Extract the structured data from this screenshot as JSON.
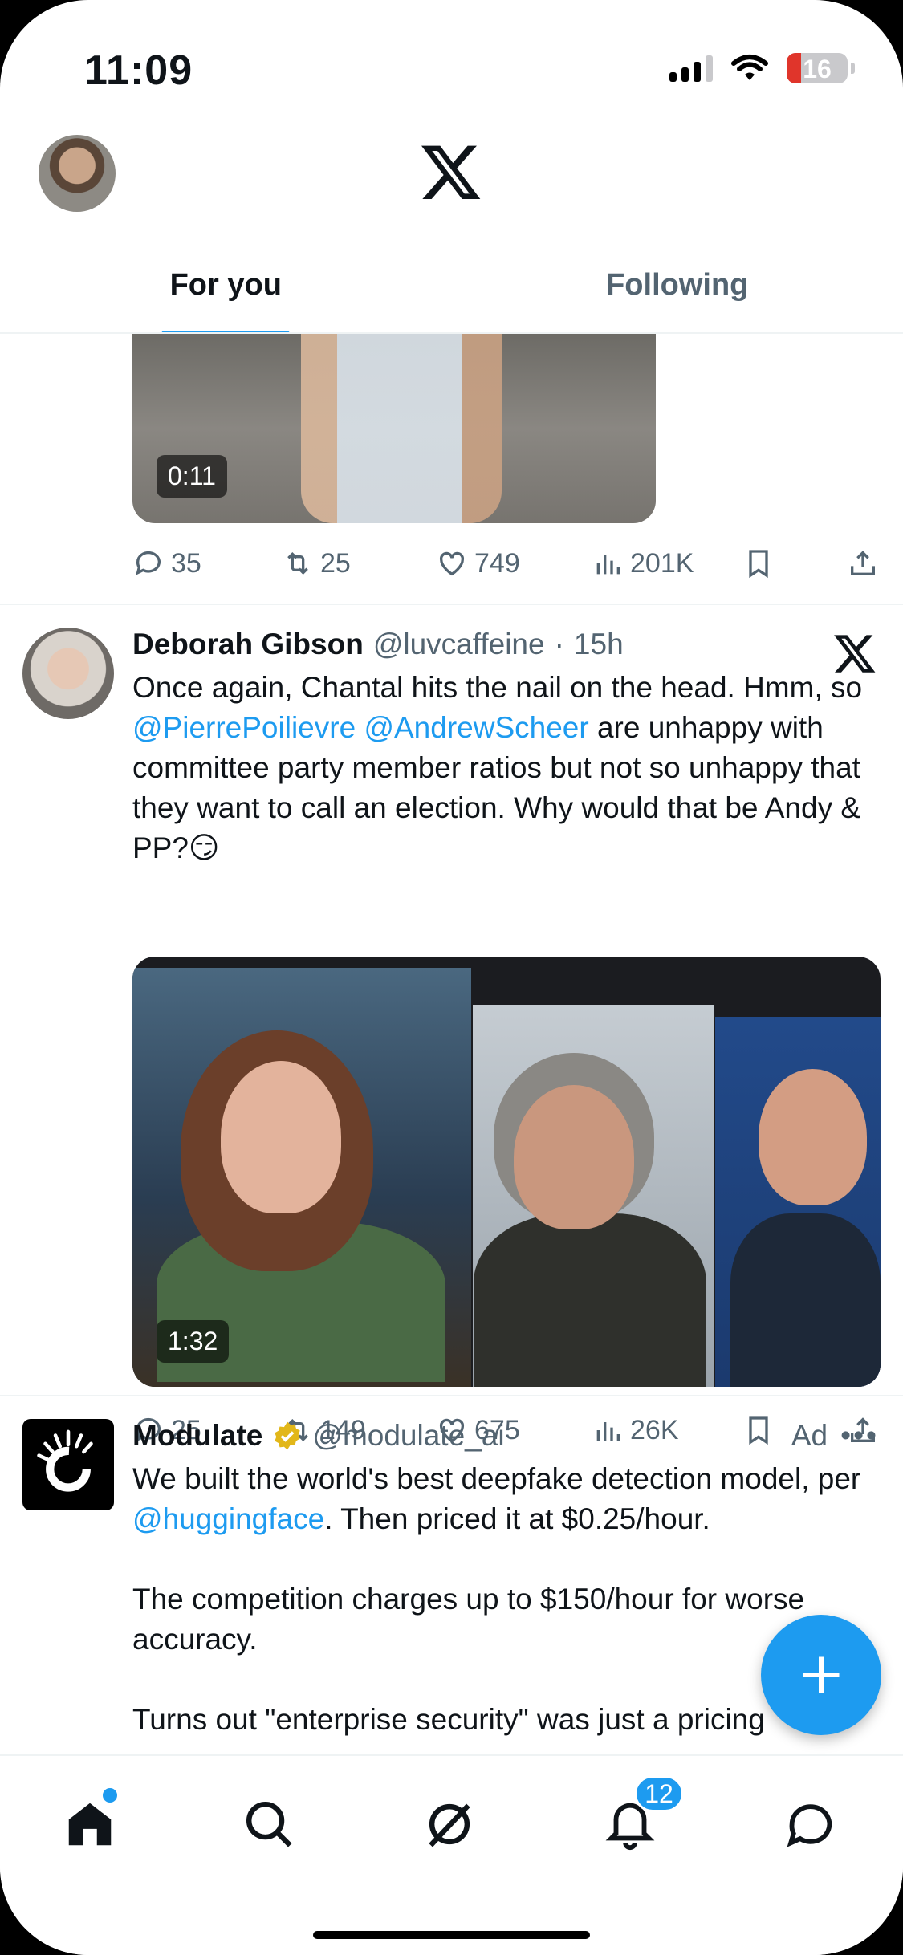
{
  "status_bar": {
    "time": "11:09",
    "battery": "16"
  },
  "header": {
    "tabs": [
      {
        "label": "For you",
        "active": true
      },
      {
        "label": "Following",
        "active": false
      }
    ]
  },
  "tweet0": {
    "video_duration": "0:11",
    "actions": {
      "replies": "35",
      "reposts": "25",
      "likes": "749",
      "views": "201K"
    }
  },
  "tweet1": {
    "name": "Deborah Gibson",
    "handle": "@luvcaffeine",
    "time": "15h",
    "text_a": "Once again, Chantal hits the nail on the head. Hmm, so ",
    "mention1": "@PierrePoilievre",
    "mention2": "@AndrewScheer",
    "text_b": " are unhappy with committee party member ratios but not so unhappy that they want to call an election. Why would that be Andy & PP?😏",
    "video_duration": "1:32",
    "actions": {
      "replies": "25",
      "reposts": "149",
      "likes": "675",
      "views": "26K"
    }
  },
  "tweet2": {
    "name": "Modulate",
    "handle": "@modulate_ai",
    "ad_label": "Ad",
    "text_a": "We built the world's best deepfake detection model, per ",
    "mention": "@huggingface",
    "text_b": ". Then priced it at $0.25/hour.\n\nThe competition charges up to $150/hour for worse accuracy.\n\nTurns out \"enterprise security\" was just a pricing"
  },
  "bottom_nav": {
    "items": [
      "home-icon",
      "search-icon",
      "grok-icon",
      "notifications-icon",
      "messages-icon"
    ],
    "notifications_badge": "12"
  },
  "colors": {
    "accent": "#1d9bf0",
    "text": "#0f1419",
    "secondary": "#536471"
  }
}
